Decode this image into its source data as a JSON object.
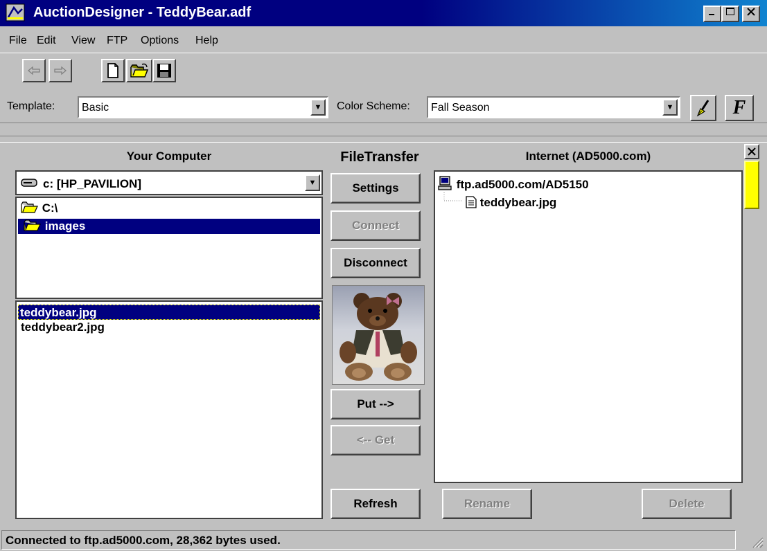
{
  "window": {
    "title": "AuctionDesigner - TeddyBear.adf",
    "controls": [
      "minimize-icon",
      "maximize-icon",
      "close-icon"
    ]
  },
  "menu": {
    "items": [
      {
        "label": "File"
      },
      {
        "label": "Edit"
      },
      {
        "label": "View"
      },
      {
        "label": "FTP"
      },
      {
        "label": "Options"
      },
      {
        "label": "Help"
      }
    ]
  },
  "toolbar": {
    "template_label": "Template:",
    "template_value": "Basic",
    "color_scheme_label": "Color Scheme:",
    "color_scheme_value": "Fall Season",
    "font_button_glyph": "F"
  },
  "left_panel": {
    "header": "Your Computer",
    "drive": "c: [HP_PAVILION]",
    "folders": [
      {
        "label": "C:\\"
      },
      {
        "label": "images"
      }
    ],
    "files": [
      {
        "label": "teddybear.jpg"
      },
      {
        "label": "teddybear2.jpg"
      }
    ]
  },
  "middle_panel": {
    "header": "FileTransfer",
    "buttons": {
      "settings": "Settings",
      "connect": "Connect",
      "disconnect": "Disconnect",
      "put": "Put -->",
      "get": "<-- Get",
      "refresh": "Refresh"
    }
  },
  "right_panel": {
    "header": "Internet (AD5000.com)",
    "server": "ftp.ad5000.com/AD5150",
    "remote_file": "teddybear.jpg",
    "buttons": {
      "rename": "Rename",
      "delete": "Delete"
    }
  },
  "statusbar": {
    "text": "Connected to ftp.ad5000.com, 28,362 bytes used."
  },
  "colors": {
    "title_bar": "#000080",
    "selection": "#000080",
    "window_bg": "#c0c0c0",
    "scroll_thumb": "#ffff00"
  }
}
